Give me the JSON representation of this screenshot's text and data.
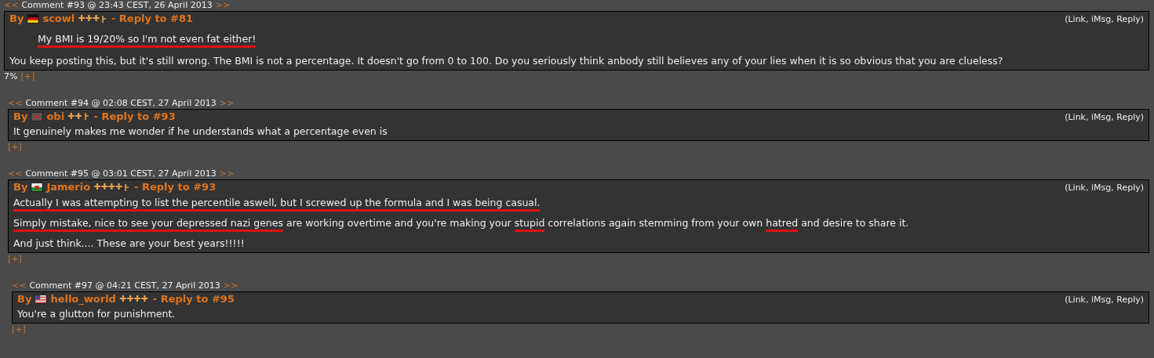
{
  "comments": [
    {
      "number": "Comment #93 @ 23:43 CEST, 26 April 2013",
      "prev": "<<",
      "next": ">>",
      "by": "By",
      "flag": {
        "kind": "de"
      },
      "author": "scowl",
      "rank": "✚✚✚",
      "badge": true,
      "reply_to": "- Reply to #81",
      "actions": "(Link, iMsg, Reply)",
      "paragraphs": [
        [
          {
            "text": "My BMI is 19/20% so I'm not even fat either!",
            "underlined": true,
            "quote": true
          }
        ],
        [
          {
            "text": "You keep posting this, but it's still wrong. The BMI is not a percentage. It doesn't go from 0 to 100. Do you seriously think anbody still believes any of your lies when it is so obvious that you are clueless?",
            "underlined": false
          }
        ]
      ],
      "score": "7%",
      "expand": "[+]",
      "children": [
        {
          "number": "Comment #94 @ 02:08 CEST, 27 April 2013",
          "prev": "<<",
          "next": ">>",
          "by": "By",
          "flag": {
            "kind": "x"
          },
          "author": "obi",
          "rank": "✚✚",
          "badge": true,
          "reply_to": "- Reply to #93",
          "actions": "(Link, iMsg, Reply)",
          "paragraphs": [
            [
              {
                "text": "It genuinely makes me wonder if he understands what a percentage even is",
                "underlined": false
              }
            ]
          ],
          "expand": "[+]"
        },
        {
          "number": "Comment #95 @ 03:01 CEST, 27 April 2013",
          "prev": "<<",
          "next": ">>",
          "by": "By",
          "flag": {
            "kind": "wales"
          },
          "author": "Jamerio",
          "rank": "✚✚✚✚",
          "badge": true,
          "reply_to": "- Reply to #93",
          "actions": "(Link, iMsg, Reply)",
          "paragraphs": [
            [
              {
                "text": "Actually I was attempting to list the percentile aswell, but I screwed up the formula and I was being casual.",
                "underlined": true
              }
            ],
            [
              {
                "text": "Simply mistake, nice to see your depressed nazi genes",
                "underlined": true
              },
              {
                "text": " are working overtime and you're making your ",
                "underlined": false
              },
              {
                "text": "stupid",
                "underlined": true
              },
              {
                "text": " correlations again stemming from your own ",
                "underlined": false
              },
              {
                "text": "hatred",
                "underlined": true
              },
              {
                "text": " and desire to share it.",
                "underlined": false
              }
            ],
            [
              {
                "text": "And just think.... These are your best years!!!!!",
                "underlined": false
              }
            ]
          ],
          "expand": "[+]",
          "children": [
            {
              "number": "Comment #97 @ 04:21 CEST, 27 April 2013",
              "prev": "<<",
              "next": ">>",
              "by": "By",
              "flag": {
                "kind": "us"
              },
              "author": "hello_world",
              "rank": "✚✚✚✚",
              "badge": false,
              "reply_to": "- Reply to #95",
              "actions": "(Link, iMsg, Reply)",
              "paragraphs": [
                [
                  {
                    "text": "You're a glutton for punishment.",
                    "underlined": false
                  }
                ]
              ],
              "expand": "[+]"
            }
          ]
        }
      ]
    }
  ]
}
